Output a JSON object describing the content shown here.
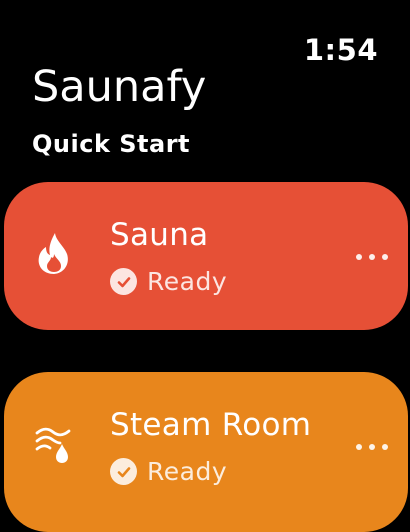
{
  "status_bar": {
    "time": "1:54"
  },
  "header": {
    "app_title": "Saunafy",
    "section_title": "Quick Start"
  },
  "cards": [
    {
      "name": "Sauna",
      "status": "Ready",
      "icon": "flame-icon",
      "color": "#E65036"
    },
    {
      "name": "Steam Room",
      "status": "Ready",
      "icon": "steam-icon",
      "color": "#E8861C"
    }
  ],
  "colors": {
    "background": "#000000",
    "text": "#FFFFFF"
  }
}
